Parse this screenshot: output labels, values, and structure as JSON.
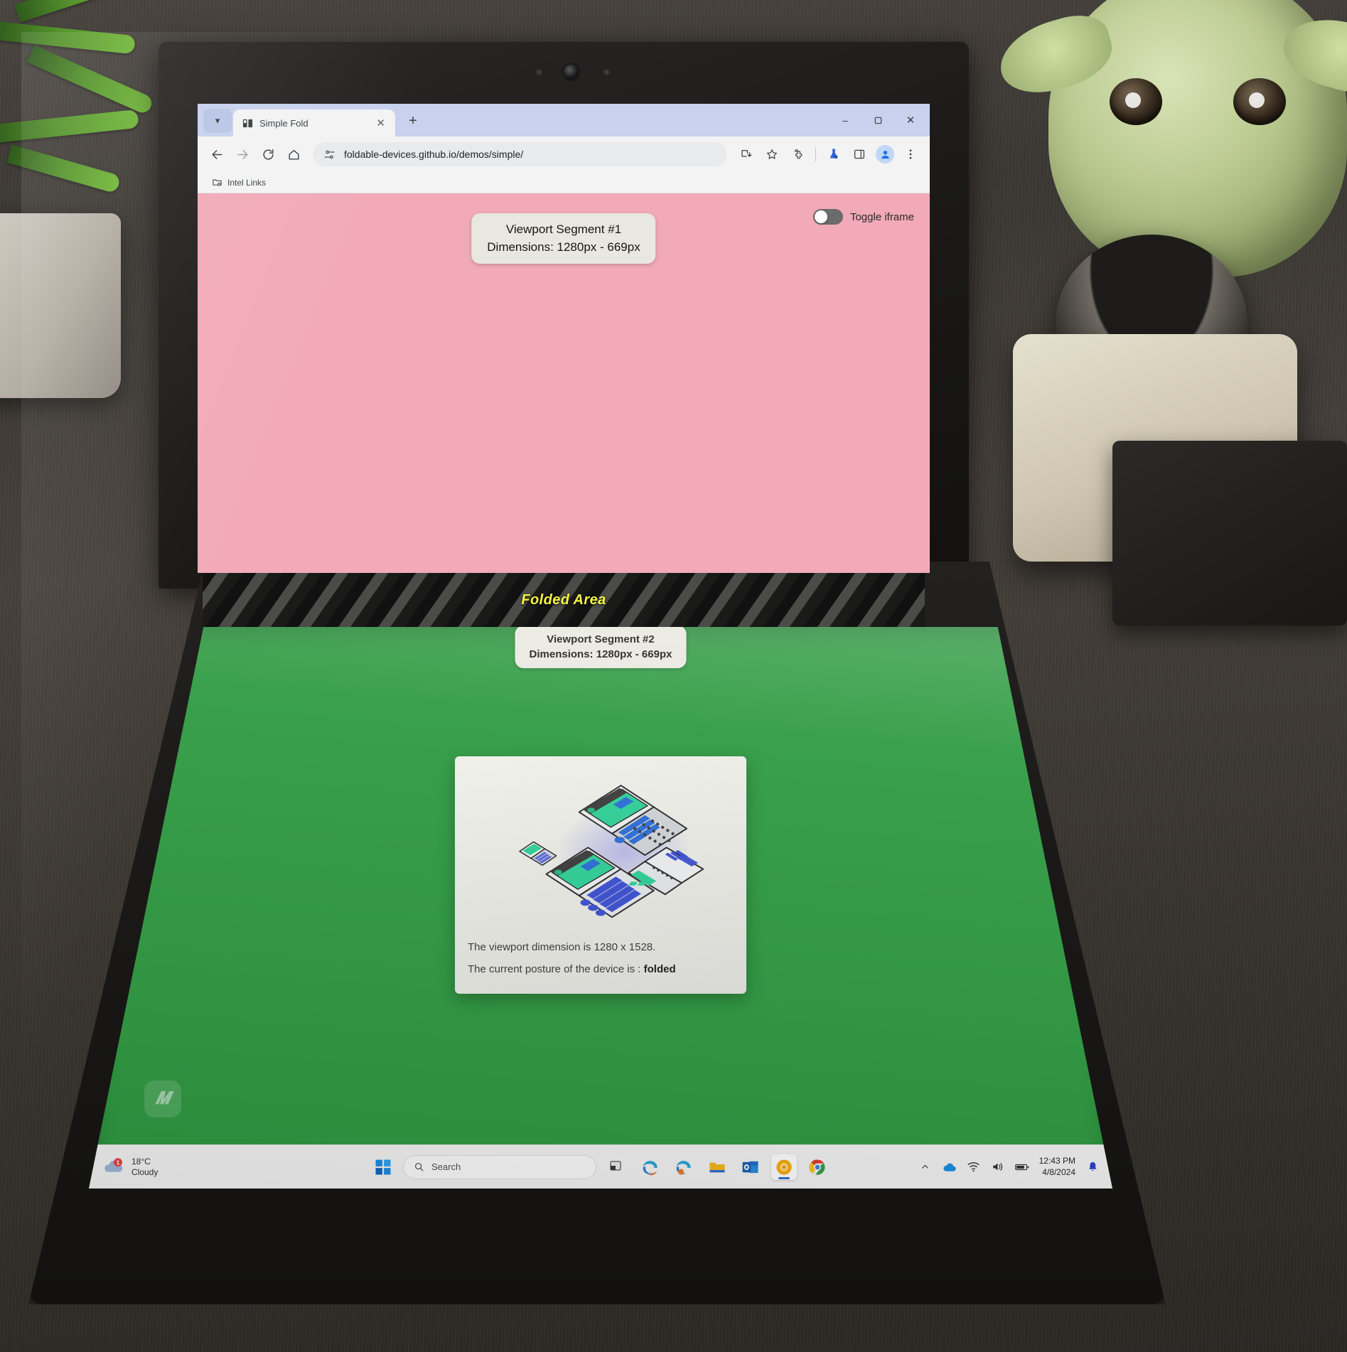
{
  "browser": {
    "tab": {
      "title": "Simple Fold",
      "favicon_icon": "book-favicon",
      "close_icon": "close-icon"
    },
    "tab_chevron_icon": "chevron-down-icon",
    "new_tab_icon": "plus-icon",
    "window_controls": {
      "minimize": "–",
      "maximize": "❐",
      "close": "✕"
    },
    "nav": {
      "back_icon": "back-arrow-icon",
      "forward_icon": "forward-arrow-icon",
      "reload_icon": "reload-icon",
      "home_icon": "home-icon"
    },
    "omnibox": {
      "site_settings_icon": "tune-icon",
      "url": "foldable-devices.github.io/demos/simple/"
    },
    "actions": {
      "install_icon": "install-app-icon",
      "bookmark_icon": "star-icon",
      "extensions_icon": "puzzle-piece-icon",
      "labs_icon": "labs-flask-icon",
      "side_panel_icon": "side-panel-icon",
      "profile_icon": "profile-avatar-icon",
      "menu_icon": "three-dot-menu-icon"
    },
    "bookmarks": [
      {
        "label": "Intel Links",
        "icon": "folder-gear-icon"
      }
    ]
  },
  "page": {
    "segment1": {
      "title": "Viewport Segment #1",
      "dimensions": "Dimensions: 1280px - 669px",
      "background_color": "#f2aab8"
    },
    "fold": {
      "label": "Folded Area",
      "label_color": "#f5f542"
    },
    "segment2": {
      "title": "Viewport Segment #2",
      "dimensions": "Dimensions: 1280px - 669px",
      "background_color": "#2f9b42"
    },
    "toggle_iframe": {
      "label": "Toggle iframe",
      "state": "off"
    },
    "card": {
      "illustration_icon": "foldable-devices-illustration",
      "line1": "The viewport dimension is 1280 x 1528.",
      "line2_prefix": "The current posture of the device is : ",
      "line2_value": "folded"
    }
  },
  "taskbar": {
    "weather": {
      "temperature": "18°C",
      "condition": "Cloudy",
      "badge": "1",
      "icon": "cloud-icon"
    },
    "start_icon": "windows-start-icon",
    "search": {
      "placeholder": "Search",
      "icon": "search-icon"
    },
    "apps": [
      {
        "name": "task-view",
        "icon": "task-view-icon",
        "active": false
      },
      {
        "name": "edge",
        "icon": "edge-icon",
        "active": false
      },
      {
        "name": "edge-dev",
        "icon": "edge-dev-icon",
        "active": false
      },
      {
        "name": "file-explorer",
        "icon": "folder-icon",
        "active": false
      },
      {
        "name": "outlook",
        "icon": "outlook-icon",
        "active": false
      },
      {
        "name": "chrome-canary",
        "icon": "chrome-canary-icon",
        "active": true
      },
      {
        "name": "chrome",
        "icon": "chrome-icon",
        "active": false
      }
    ],
    "tray": {
      "overflow_icon": "chevron-up-icon",
      "onedrive_icon": "cloud-icon",
      "wifi_icon": "wifi-icon",
      "volume_icon": "speaker-icon",
      "battery_icon": "battery-icon",
      "notification_icon": "bell-icon"
    },
    "clock": {
      "time": "12:43 PM",
      "date": "4/8/2024"
    }
  }
}
